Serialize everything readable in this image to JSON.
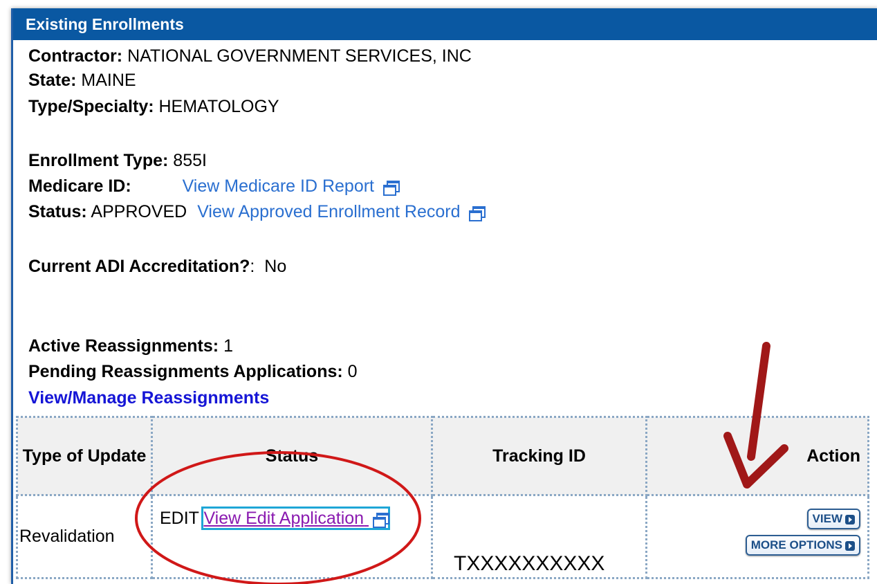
{
  "header": {
    "title": "Existing Enrollments"
  },
  "info": {
    "contractor_label": "Contractor:",
    "contractor_value": "NATIONAL GOVERNMENT SERVICES, INC",
    "state_label": "State:",
    "state_value": "MAINE",
    "specialty_label": "Type/Specialty:",
    "specialty_value": "HEMATOLOGY",
    "enrollment_type_label": "Enrollment Type:",
    "enrollment_type_value": "855I",
    "medicare_id_label": "Medicare ID:",
    "medicare_id_link": "View Medicare ID Report",
    "status_label": "Status:",
    "status_value": "APPROVED",
    "status_link": "View Approved Enrollment Record",
    "adi_label": "Current ADI Accreditation?",
    "adi_value": "No",
    "active_label": "Active Reassignments:",
    "active_value": "1",
    "pending_label": "Pending Reassignments Applications:",
    "pending_value": "0",
    "manage_link": "View/Manage Reassignments"
  },
  "table": {
    "headers": [
      "Type of Update",
      "Status",
      "Tracking ID",
      "Action"
    ],
    "row": {
      "type": "Revalidation",
      "status_value": "EDIT",
      "status_link": "View Edit Application",
      "tracking_id": "TXXXXXXXXXX",
      "view_button": "VIEW",
      "more_button": "MORE OPTIONS"
    }
  },
  "icons": [
    "external-window-icon",
    "arrow-right-icon"
  ],
  "colors": {
    "header_bg": "#0a58a2",
    "link": "#2a6fd0",
    "annotation_red": "#d01818",
    "annotation_arrow": "#a01818"
  }
}
